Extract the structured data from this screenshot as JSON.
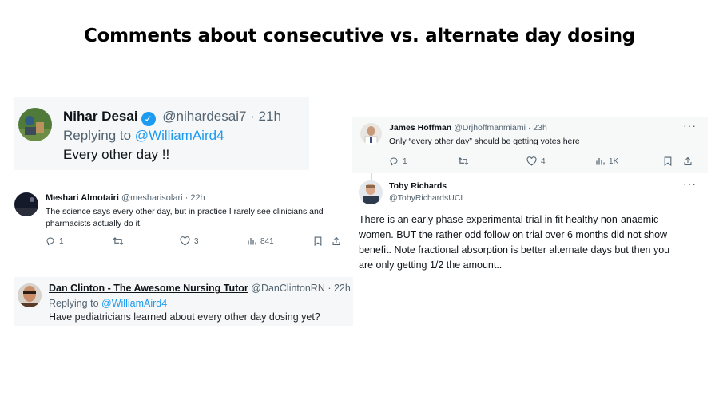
{
  "title": "Comments about consecutive vs. alternate day dosing",
  "colors": {
    "link": "#1d9bf0",
    "muted": "#536471",
    "verified": "#1d9bf0",
    "card_bg": "#f5f7f8"
  },
  "tweets": {
    "nihar": {
      "name": "Nihar Desai",
      "handle": "@nihardesai7 · 21h",
      "replying_prefix": "Replying to",
      "replying_to": "@WilliamAird4",
      "text": "Every other day !!",
      "verified": true
    },
    "meshari": {
      "name": "Meshari Almotairi",
      "handle": "@mesharisolari · 22h",
      "text_line1": "The science says every other day, but in practice I rarely see clinicians and",
      "text_line2": "pharmacists actually do it.",
      "replies": "1",
      "likes": "3",
      "views": "841"
    },
    "dan": {
      "name": "Dan Clinton - The Awesome Nursing Tutor",
      "handle": "@DanClintonRN · 22h",
      "replying_prefix": "Replying to",
      "replying_to": "@WilliamAird4",
      "text": "Have pediatricians learned about every other day dosing yet?"
    },
    "james": {
      "name": "James Hoffman",
      "handle": "@Drjhoffmanmiami · 23h",
      "text": "Only “every other day” should be getting votes here",
      "replies": "1",
      "likes": "4",
      "views": "1K"
    },
    "toby": {
      "name": "Toby Richards",
      "handle": "@TobyRichardsUCL",
      "text_line1": "There is an early phase experimental trial in fit healthy non-anaemic",
      "text_line2": "women. BUT the rather odd follow on trial over 6 months did not show",
      "text_line3": "benefit. Note fractional absorption is better alternate days but then you",
      "text_line4": "are only getting 1/2 the amount.."
    }
  }
}
